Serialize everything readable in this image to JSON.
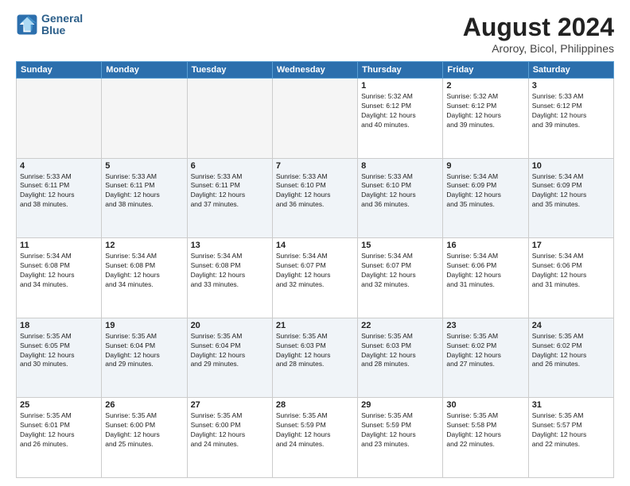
{
  "header": {
    "logo_line1": "General",
    "logo_line2": "Blue",
    "main_title": "August 2024",
    "subtitle": "Aroroy, Bicol, Philippines"
  },
  "columns": [
    "Sunday",
    "Monday",
    "Tuesday",
    "Wednesday",
    "Thursday",
    "Friday",
    "Saturday"
  ],
  "weeks": [
    [
      {
        "day": "",
        "info": ""
      },
      {
        "day": "",
        "info": ""
      },
      {
        "day": "",
        "info": ""
      },
      {
        "day": "",
        "info": ""
      },
      {
        "day": "1",
        "info": "Sunrise: 5:32 AM\nSunset: 6:12 PM\nDaylight: 12 hours\nand 40 minutes."
      },
      {
        "day": "2",
        "info": "Sunrise: 5:32 AM\nSunset: 6:12 PM\nDaylight: 12 hours\nand 39 minutes."
      },
      {
        "day": "3",
        "info": "Sunrise: 5:33 AM\nSunset: 6:12 PM\nDaylight: 12 hours\nand 39 minutes."
      }
    ],
    [
      {
        "day": "4",
        "info": "Sunrise: 5:33 AM\nSunset: 6:11 PM\nDaylight: 12 hours\nand 38 minutes."
      },
      {
        "day": "5",
        "info": "Sunrise: 5:33 AM\nSunset: 6:11 PM\nDaylight: 12 hours\nand 38 minutes."
      },
      {
        "day": "6",
        "info": "Sunrise: 5:33 AM\nSunset: 6:11 PM\nDaylight: 12 hours\nand 37 minutes."
      },
      {
        "day": "7",
        "info": "Sunrise: 5:33 AM\nSunset: 6:10 PM\nDaylight: 12 hours\nand 36 minutes."
      },
      {
        "day": "8",
        "info": "Sunrise: 5:33 AM\nSunset: 6:10 PM\nDaylight: 12 hours\nand 36 minutes."
      },
      {
        "day": "9",
        "info": "Sunrise: 5:34 AM\nSunset: 6:09 PM\nDaylight: 12 hours\nand 35 minutes."
      },
      {
        "day": "10",
        "info": "Sunrise: 5:34 AM\nSunset: 6:09 PM\nDaylight: 12 hours\nand 35 minutes."
      }
    ],
    [
      {
        "day": "11",
        "info": "Sunrise: 5:34 AM\nSunset: 6:08 PM\nDaylight: 12 hours\nand 34 minutes."
      },
      {
        "day": "12",
        "info": "Sunrise: 5:34 AM\nSunset: 6:08 PM\nDaylight: 12 hours\nand 34 minutes."
      },
      {
        "day": "13",
        "info": "Sunrise: 5:34 AM\nSunset: 6:08 PM\nDaylight: 12 hours\nand 33 minutes."
      },
      {
        "day": "14",
        "info": "Sunrise: 5:34 AM\nSunset: 6:07 PM\nDaylight: 12 hours\nand 32 minutes."
      },
      {
        "day": "15",
        "info": "Sunrise: 5:34 AM\nSunset: 6:07 PM\nDaylight: 12 hours\nand 32 minutes."
      },
      {
        "day": "16",
        "info": "Sunrise: 5:34 AM\nSunset: 6:06 PM\nDaylight: 12 hours\nand 31 minutes."
      },
      {
        "day": "17",
        "info": "Sunrise: 5:34 AM\nSunset: 6:06 PM\nDaylight: 12 hours\nand 31 minutes."
      }
    ],
    [
      {
        "day": "18",
        "info": "Sunrise: 5:35 AM\nSunset: 6:05 PM\nDaylight: 12 hours\nand 30 minutes."
      },
      {
        "day": "19",
        "info": "Sunrise: 5:35 AM\nSunset: 6:04 PM\nDaylight: 12 hours\nand 29 minutes."
      },
      {
        "day": "20",
        "info": "Sunrise: 5:35 AM\nSunset: 6:04 PM\nDaylight: 12 hours\nand 29 minutes."
      },
      {
        "day": "21",
        "info": "Sunrise: 5:35 AM\nSunset: 6:03 PM\nDaylight: 12 hours\nand 28 minutes."
      },
      {
        "day": "22",
        "info": "Sunrise: 5:35 AM\nSunset: 6:03 PM\nDaylight: 12 hours\nand 28 minutes."
      },
      {
        "day": "23",
        "info": "Sunrise: 5:35 AM\nSunset: 6:02 PM\nDaylight: 12 hours\nand 27 minutes."
      },
      {
        "day": "24",
        "info": "Sunrise: 5:35 AM\nSunset: 6:02 PM\nDaylight: 12 hours\nand 26 minutes."
      }
    ],
    [
      {
        "day": "25",
        "info": "Sunrise: 5:35 AM\nSunset: 6:01 PM\nDaylight: 12 hours\nand 26 minutes."
      },
      {
        "day": "26",
        "info": "Sunrise: 5:35 AM\nSunset: 6:00 PM\nDaylight: 12 hours\nand 25 minutes."
      },
      {
        "day": "27",
        "info": "Sunrise: 5:35 AM\nSunset: 6:00 PM\nDaylight: 12 hours\nand 24 minutes."
      },
      {
        "day": "28",
        "info": "Sunrise: 5:35 AM\nSunset: 5:59 PM\nDaylight: 12 hours\nand 24 minutes."
      },
      {
        "day": "29",
        "info": "Sunrise: 5:35 AM\nSunset: 5:59 PM\nDaylight: 12 hours\nand 23 minutes."
      },
      {
        "day": "30",
        "info": "Sunrise: 5:35 AM\nSunset: 5:58 PM\nDaylight: 12 hours\nand 22 minutes."
      },
      {
        "day": "31",
        "info": "Sunrise: 5:35 AM\nSunset: 5:57 PM\nDaylight: 12 hours\nand 22 minutes."
      }
    ]
  ]
}
